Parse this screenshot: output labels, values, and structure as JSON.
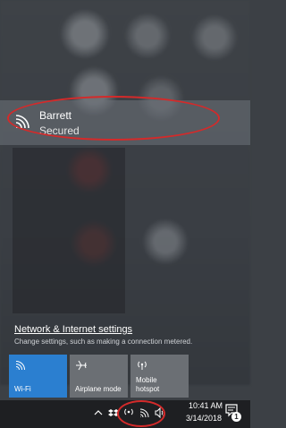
{
  "network": {
    "name": "Barrett",
    "status": "Secured"
  },
  "settings": {
    "link_label": "Network & Internet settings",
    "description": "Change settings, such as making a connection metered."
  },
  "quick_actions": [
    {
      "label": "Wi-Fi",
      "icon": "wifi-icon",
      "active": true
    },
    {
      "label": "Airplane mode",
      "icon": "airplane-icon",
      "active": false
    },
    {
      "label": "Mobile\nhotspot",
      "icon": "hotspot-icon",
      "active": false
    }
  ],
  "taskbar": {
    "time": "10:41 AM",
    "date": "3/14/2018",
    "notification_count": "1"
  },
  "colors": {
    "accent": "#2b7fd0",
    "annotation": "#d42a2a"
  }
}
